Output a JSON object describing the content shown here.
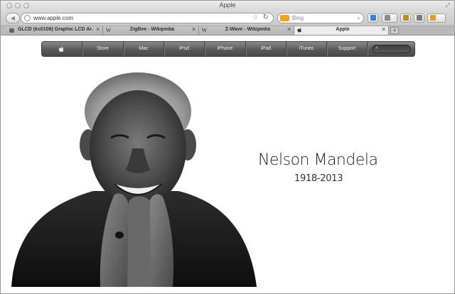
{
  "window": {
    "title": "Apple"
  },
  "toolbar": {
    "url": "www.apple.com",
    "search_placeholder": "Bing",
    "search_engine_icon": "bing-icon"
  },
  "tabs": [
    {
      "label": "GLCD (ks0108) Graphic LCD Ar…",
      "favicon": "▦",
      "active": false
    },
    {
      "label": "ZigBee - Wikipedia",
      "favicon": "W",
      "active": false
    },
    {
      "label": "Z-Wave - Wikipedia",
      "favicon": "W",
      "active": false
    },
    {
      "label": "Apple",
      "favicon": "",
      "active": true
    }
  ],
  "nav": {
    "items": [
      "Store",
      "Mac",
      "iPod",
      "iPhone",
      "iPad",
      "iTunes",
      "Support"
    ]
  },
  "hero": {
    "name": "Nelson Mandela",
    "years": "1918-2013"
  },
  "colors": {
    "nav_dark": "#4a4a4a",
    "page_bg": "#ffffff",
    "search_accent": "#f3a417"
  }
}
